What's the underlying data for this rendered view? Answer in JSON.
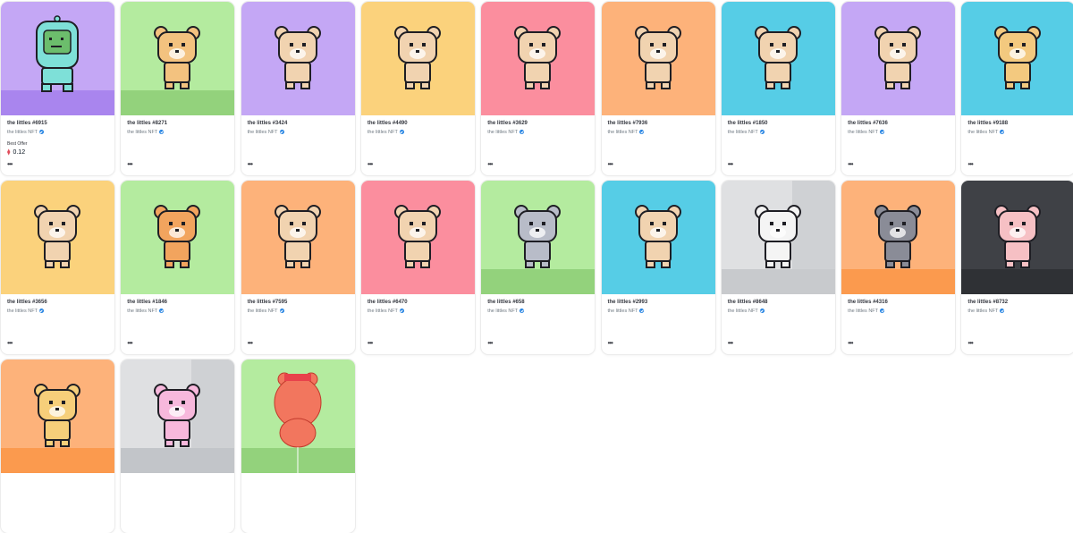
{
  "collection_label": "the littles NFT",
  "best_offer_label": "Best Offer",
  "more_label": "•••",
  "items": [
    {
      "name": "the littles #6915",
      "bg": "#c4a7f5",
      "floor": "#a985ee",
      "body": "#7ee0d8",
      "offer": "0.12",
      "icon": "robot-figure"
    },
    {
      "name": "the littles #8271",
      "bg": "#b4eb9f",
      "floor": "#93d27c",
      "body": "#f3c27f",
      "icon": "bear-figure"
    },
    {
      "name": "the littles #3424",
      "bg": "#c4a7f5",
      "floor": "",
      "body": "#f1d3b0",
      "icon": "bear-figure"
    },
    {
      "name": "the littles #4490",
      "bg": "#fbd27c",
      "floor": "",
      "body": "#f1d3b0",
      "icon": "bear-figure"
    },
    {
      "name": "the littles #3629",
      "bg": "#fb8e9e",
      "floor": "",
      "body": "#f1d3b0",
      "icon": "bear-figure"
    },
    {
      "name": "the littles #7936",
      "bg": "#fdb27a",
      "floor": "",
      "body": "#f1d3b0",
      "icon": "bear-figure"
    },
    {
      "name": "the littles #1850",
      "bg": "#56cde6",
      "floor": "",
      "body": "#f1d3b0",
      "icon": "bear-figure"
    },
    {
      "name": "the littles #7636",
      "bg": "#c4a7f5",
      "floor": "",
      "body": "#f1d3b0",
      "icon": "bear-figure"
    },
    {
      "name": "the littles #9188",
      "bg": "#56cde6",
      "floor": "",
      "body": "#f3c97f",
      "icon": "bear-figure"
    },
    {
      "name": "the littles #3656",
      "bg": "#fbd27c",
      "floor": "",
      "body": "#f1d3b0",
      "icon": "bear-figure"
    },
    {
      "name": "the littles #1846",
      "bg": "#b4eb9f",
      "floor": "",
      "body": "#f2a45e",
      "icon": "bear-figure"
    },
    {
      "name": "the littles #7595",
      "bg": "#fdb27a",
      "floor": "",
      "body": "#f1d3b0",
      "icon": "bear-figure"
    },
    {
      "name": "the littles #6470",
      "bg": "#fb8e9e",
      "floor": "",
      "body": "#f1d3b0",
      "icon": "bear-figure"
    },
    {
      "name": "the littles #658",
      "bg": "#b4eb9f",
      "floor": "#93d27c",
      "body": "#b8bcc8",
      "icon": "bear-figure"
    },
    {
      "name": "the littles #2993",
      "bg": "#56cde6",
      "floor": "",
      "body": "#f1d3b0",
      "icon": "bear-figure"
    },
    {
      "name": "the littles #8648",
      "bg": "#dfe0e2",
      "floor": "#c8cacd",
      "wall": "#cfd1d4",
      "body": "#f4f4f4",
      "icon": "bear-figure"
    },
    {
      "name": "the littles #4316",
      "bg": "#fdb27a",
      "floor": "#fb9a4e",
      "body": "#8a8c97",
      "icon": "bear-figure"
    },
    {
      "name": "the littles #8732",
      "bg": "#3f4146",
      "floor": "#2f3135",
      "body": "#f6c0c4",
      "icon": "bear-figure"
    },
    {
      "name": "",
      "bg": "#fdb27a",
      "floor": "#fb9a4e",
      "body": "#f6cf7a",
      "icon": "bear-figure"
    },
    {
      "name": "",
      "bg": "#dfe0e2",
      "floor": "#c2c5c9",
      "wall": "#cfd1d4",
      "body": "#f7b8dc",
      "icon": "bear-figure"
    },
    {
      "name": "",
      "bg": "#b4eb9f",
      "floor": "#93d27c",
      "body": "#f2765e",
      "icon": "balloon-bear-figure"
    }
  ]
}
